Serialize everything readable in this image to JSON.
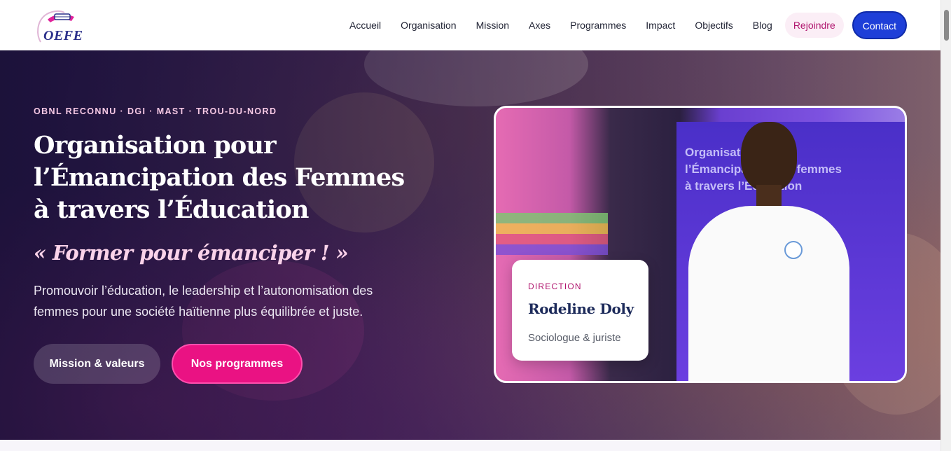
{
  "header": {
    "logo_text": "OEFE",
    "nav": [
      "Accueil",
      "Organisation",
      "Mission",
      "Axes",
      "Programmes",
      "Impact",
      "Objectifs",
      "Blog"
    ],
    "join_label": "Rejoindre",
    "contact_label": "Contact"
  },
  "hero": {
    "eyebrow": "OBNL RECONNU · DGI · MAST · TROU-DU-NORD",
    "title": "Organisation pour l’Émancipation des Femmes à travers l’Éducation",
    "tagline": "« Former pour émanciper ! »",
    "description": "Promouvoir l’éducation, le leadership et l’autonomisation des femmes pour une société haïtienne plus équilibrée et juste.",
    "btn_mission": "Mission & valeurs",
    "btn_programs": "Nos programmes"
  },
  "feature": {
    "photo_banner_text": "Organisation pour l’Émancipation des femmes à travers l’Éducation",
    "card": {
      "role": "DIRECTION",
      "name": "Rodeline Doly",
      "subtitle": "Sociologue & juriste"
    }
  },
  "colors": {
    "accent_pink": "#ea1283",
    "primary_blue": "#1e3fd8",
    "title_navy": "#1c2a5a"
  }
}
